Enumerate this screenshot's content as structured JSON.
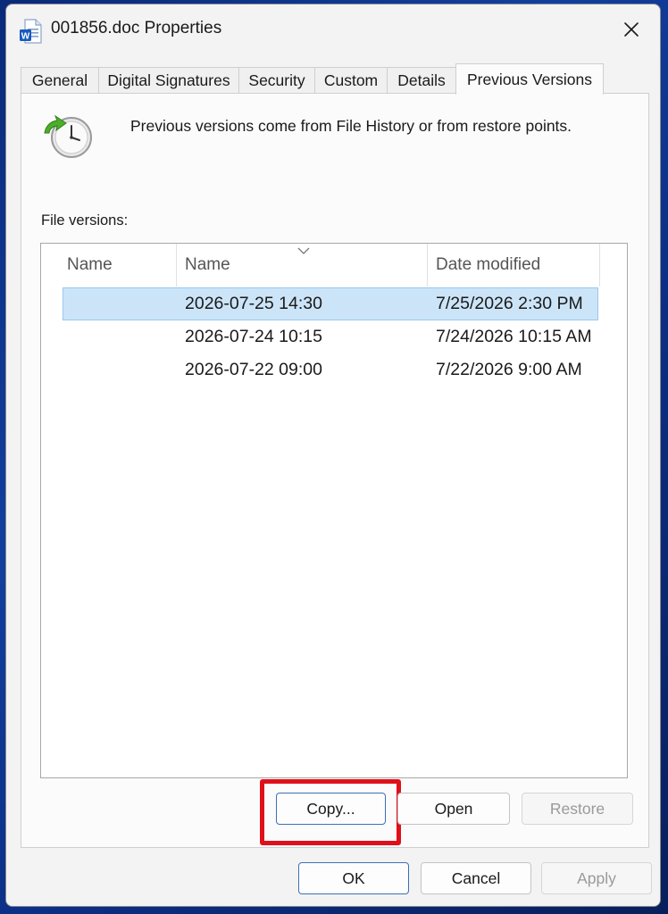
{
  "window": {
    "title": "001856.doc Properties",
    "app_icon": "word-document-icon",
    "close_icon": "close-icon"
  },
  "tabs": [
    {
      "label": "General",
      "active": false
    },
    {
      "label": "Digital Signatures",
      "active": false
    },
    {
      "label": "Security",
      "active": false
    },
    {
      "label": "Custom",
      "active": false
    },
    {
      "label": "Details",
      "active": false
    },
    {
      "label": "Previous Versions",
      "active": true
    }
  ],
  "panel": {
    "icon": "restore-clock-icon",
    "description": "Previous versions come from File History or from restore points.",
    "file_versions_label": "File versions:"
  },
  "list": {
    "columns": [
      "Name",
      "Name",
      "Date modified"
    ],
    "sort_icon": "sort-caret-down-icon",
    "rows": [
      {
        "name": "2026-07-25 14:30",
        "date_modified": "7/25/2026 2:30 PM",
        "selected": true
      },
      {
        "name": "2026-07-24 10:15",
        "date_modified": "7/24/2026 10:15 AM",
        "selected": false
      },
      {
        "name": "2026-07-22 09:00",
        "date_modified": "7/22/2026 9:00 AM",
        "selected": false
      }
    ]
  },
  "actions": {
    "copy": "Copy...",
    "open": "Open",
    "restore": "Restore"
  },
  "footer": {
    "ok": "OK",
    "cancel": "Cancel",
    "apply": "Apply"
  },
  "colors": {
    "selection": "#cce4f7",
    "highlight_box": "#e0101a",
    "primary_border": "#3b6fb5"
  }
}
